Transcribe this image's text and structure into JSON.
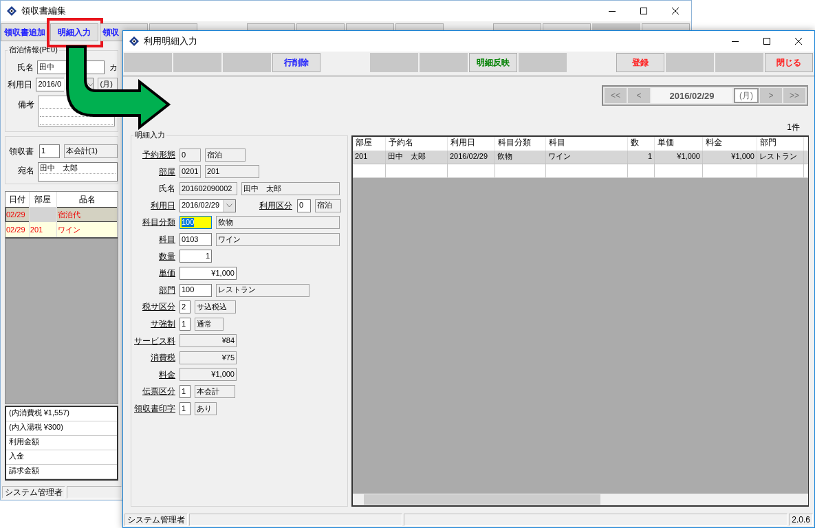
{
  "back_window": {
    "title": "領収書編集",
    "toolbar_groups": [
      [
        {
          "label": "領収書追加",
          "color": "#1a1aff",
          "disabled": false
        },
        {
          "label": "明細入力",
          "color": "#1a1aff",
          "disabled": false,
          "highlighted": true
        },
        {
          "label": "領収",
          "color": "#1a1aff",
          "disabled": false
        },
        {
          "disabled": false
        }
      ],
      [
        {
          "disabled": false
        },
        {
          "disabled": false
        },
        {
          "disabled": false
        },
        {
          "disabled": false
        }
      ],
      [
        {
          "disabled": false
        },
        {
          "disabled": false
        },
        {
          "disabled": true
        },
        {
          "disabled": false
        }
      ]
    ],
    "stay_group": {
      "legend": "宿泊情報(Pt:0)",
      "name_label": "氏名",
      "name_value": "田中",
      "kana_label": "カ",
      "date_label": "利用日",
      "date_value": "2016/0",
      "weekday": "(月)",
      "memo_label": "備考"
    },
    "receipt": {
      "no_label": "領収書",
      "no": "1",
      "account": "本会計(1)",
      "addressee_label": "宛名",
      "addressee": "田中　太郎"
    },
    "detail_table": {
      "columns": [
        "日付",
        "部屋",
        "品名"
      ],
      "rows": [
        {
          "date": "02/29",
          "room": "",
          "item": "宿泊代",
          "selected": true
        },
        {
          "date": "02/29",
          "room": "201",
          "item": "ワイン",
          "selected": false
        }
      ]
    },
    "summary": [
      "(内消費税 ¥1,557)",
      "(内入湯税 ¥300)",
      "利用金額",
      "入金",
      "請求金額"
    ],
    "status_bar": {
      "user": "システム管理者"
    }
  },
  "front_window": {
    "title": "利用明細入力",
    "toolbar_groups": [
      [
        {
          "disabled": true
        },
        {
          "disabled": true
        },
        {
          "disabled": true
        },
        {
          "label": "行削除",
          "color": "#1a1aff",
          "disabled": false
        }
      ],
      [
        {
          "disabled": true
        },
        {
          "disabled": true
        },
        {
          "label": "明細反映",
          "color": "#008000",
          "disabled": false
        },
        {
          "disabled": true
        }
      ],
      [
        {
          "label": "登録",
          "color": "#ff2020",
          "disabled": false
        },
        {
          "disabled": true
        },
        {
          "disabled": true
        },
        {
          "label": "閉じる",
          "color": "#ff2020",
          "disabled": false
        }
      ]
    ],
    "date_nav": {
      "first": "<<",
      "prev": "<",
      "date": "2016/02/29",
      "weekday": "(月)",
      "next": ">",
      "last": ">>"
    },
    "count": "1件",
    "form": {
      "legend": "明細入力",
      "rows": [
        {
          "items": [
            {
              "kind": "label",
              "text": "予約形態",
              "underlined": true
            },
            {
              "kind": "code",
              "value": "0",
              "editable": false,
              "focused": false
            },
            {
              "kind": "text",
              "value": "宿泊",
              "editable": false,
              "focused": false
            }
          ]
        },
        {
          "items": [
            {
              "kind": "label",
              "text": "部屋",
              "underlined": true
            },
            {
              "kind": "code",
              "value": "0201",
              "editable": false,
              "focused": false
            },
            {
              "kind": "text",
              "value": "201",
              "editable": false,
              "focused": false
            }
          ]
        },
        {
          "items": [
            {
              "kind": "label",
              "text": "氏名",
              "underlined": false
            },
            {
              "kind": "code",
              "value": "201602090002",
              "editable": false,
              "focused": false
            },
            {
              "kind": "text",
              "value": "田中　太郎",
              "editable": false,
              "focused": false
            }
          ]
        },
        {
          "items": [
            {
              "kind": "label",
              "text": "利用日",
              "underlined": true
            },
            {
              "kind": "date",
              "value": "2016/02/29",
              "editable": true,
              "focused": false
            },
            {
              "kind": "label",
              "text": "利用区分",
              "underlined": true
            },
            {
              "kind": "code",
              "value": "0",
              "editable": true,
              "focused": false
            },
            {
              "kind": "text",
              "value": "宿泊",
              "editable": false,
              "focused": false
            }
          ]
        },
        {
          "items": [
            {
              "kind": "label",
              "text": "科目分類",
              "underlined": true
            },
            {
              "kind": "code",
              "value": "100",
              "editable": true,
              "focused": true
            },
            {
              "kind": "text",
              "value": "飲物",
              "editable": false,
              "focused": false
            }
          ]
        },
        {
          "items": [
            {
              "kind": "label",
              "text": "科目",
              "underlined": true
            },
            {
              "kind": "code",
              "value": "0103",
              "editable": true,
              "focused": false
            },
            {
              "kind": "text",
              "value": "ワイン",
              "editable": false,
              "focused": false
            }
          ]
        },
        {
          "items": [
            {
              "kind": "label",
              "text": "数量",
              "underlined": true
            },
            {
              "kind": "amount",
              "value": "1",
              "editable": true,
              "focused": false
            }
          ]
        },
        {
          "items": [
            {
              "kind": "label",
              "text": "単価",
              "underlined": true
            },
            {
              "kind": "amount",
              "value": "¥1,000",
              "editable": true,
              "focused": false
            }
          ]
        },
        {
          "items": [
            {
              "kind": "label",
              "text": "部門",
              "underlined": true
            },
            {
              "kind": "code",
              "value": "100",
              "editable": true,
              "focused": false
            },
            {
              "kind": "text",
              "value": "レストラン",
              "editable": false,
              "focused": false
            }
          ]
        },
        {
          "items": [
            {
              "kind": "label",
              "text": "税サ区分",
              "underlined": true
            },
            {
              "kind": "code",
              "value": "2",
              "editable": true,
              "focused": false
            },
            {
              "kind": "text",
              "value": "サ込税込",
              "editable": false,
              "focused": false
            }
          ]
        },
        {
          "items": [
            {
              "kind": "label",
              "text": "サ強制",
              "underlined": true
            },
            {
              "kind": "code",
              "value": "1",
              "editable": true,
              "focused": false
            },
            {
              "kind": "text",
              "value": "通常",
              "editable": false,
              "focused": false
            }
          ]
        },
        {
          "items": [
            {
              "kind": "label",
              "text": "サービス料",
              "underlined": true
            },
            {
              "kind": "amount",
              "value": "¥84",
              "editable": false,
              "focused": false
            }
          ]
        },
        {
          "items": [
            {
              "kind": "label",
              "text": "消費税",
              "underlined": true
            },
            {
              "kind": "amount",
              "value": "¥75",
              "editable": false,
              "focused": false
            }
          ]
        },
        {
          "items": [
            {
              "kind": "label",
              "text": "料金",
              "underlined": true
            },
            {
              "kind": "amount",
              "value": "¥1,000",
              "editable": false,
              "focused": false
            }
          ]
        },
        {
          "items": [
            {
              "kind": "label",
              "text": "伝票区分",
              "underlined": true
            },
            {
              "kind": "code",
              "value": "1",
              "editable": true,
              "focused": false
            },
            {
              "kind": "text",
              "value": "本会計",
              "editable": false,
              "focused": false
            }
          ]
        },
        {
          "items": [
            {
              "kind": "label",
              "text": "領収書印字",
              "underlined": true
            },
            {
              "kind": "code",
              "value": "1",
              "editable": true,
              "focused": false
            },
            {
              "kind": "text",
              "value": "あり",
              "editable": false,
              "focused": false
            }
          ]
        }
      ]
    },
    "grid": {
      "columns": [
        {
          "title": "部屋",
          "kind": "text"
        },
        {
          "title": "予約名",
          "kind": "text"
        },
        {
          "title": "利用日",
          "kind": "text"
        },
        {
          "title": "科目分類",
          "kind": "text"
        },
        {
          "title": "科目",
          "kind": "text"
        },
        {
          "title": "数",
          "kind": "number"
        },
        {
          "title": "単価",
          "kind": "number"
        },
        {
          "title": "料金",
          "kind": "number"
        },
        {
          "title": "部門",
          "kind": "text"
        }
      ],
      "rows": [
        {
          "cells": [
            "201",
            "田中　太郎",
            "2016/02/29",
            "飲物",
            "ワイン",
            "1",
            "¥1,000",
            "¥1,000",
            "レストラン"
          ],
          "selected": true
        }
      ]
    },
    "status_bar": {
      "user": "システム管理者",
      "version": "2.0.6"
    }
  }
}
